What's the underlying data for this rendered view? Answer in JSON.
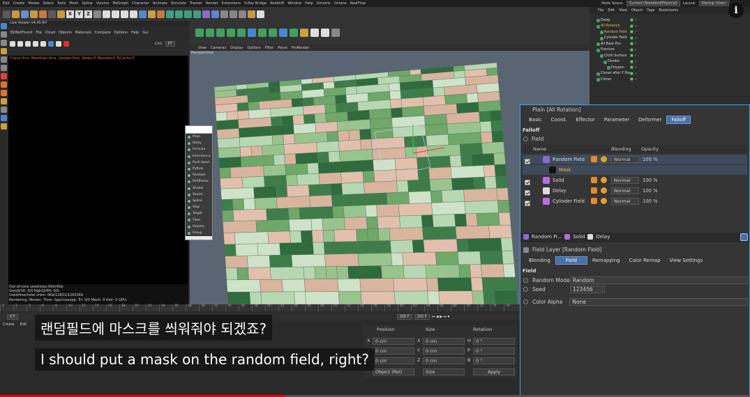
{
  "menubar": {
    "items": [
      "Edit",
      "Create",
      "Modes",
      "Select",
      "Tools",
      "Mesh",
      "Spline",
      "Volume",
      "MoGraph",
      "Character",
      "Animate",
      "Simulate",
      "Tracker",
      "Render",
      "Extensions",
      "V-Ray Bridge",
      "Redshift",
      "Window",
      "Help",
      "Omatrix",
      "Octane",
      "RealFlow"
    ],
    "node_space_label": "Node Space:",
    "node_space_value": "Current (Standard/Physical)",
    "layout_label": "Layout:",
    "layout_value": "Startup (User)"
  },
  "toolbar": {
    "axis_buttons": [
      "X",
      "Y",
      "Z"
    ]
  },
  "live_viewer": {
    "title": "Live Viewer V4.05-R7",
    "menu": [
      "File",
      "Cloud",
      "Objects",
      "Materials",
      "Compare",
      "Options",
      "Help",
      "Gui"
    ],
    "menu_prefix": "3StNotFound",
    "channel_label": "Chn:",
    "channel_value": "PT",
    "status_line": "Check:0ms, MeshGen:0ms, Update:0ms, Nodes:0 Movable:0 ToCache:0",
    "stats": [
      "Out-of-core used/max:0Kb/4Gb",
      "Grey8/16: 0/0          Rgb32/64: 0/0",
      "Used/free/total vram: 0Kb/12652/12652Kb"
    ],
    "rendering_line": "Rendering:      Ms/sec:       Time:      Spp/maxspp:        Tri: 0/0    Mesh: 0   Hair: 0      GPU:"
  },
  "viewport": {
    "menu": [
      "View",
      "Cameras",
      "Display",
      "Options",
      "Filter",
      "Panel",
      "ProRender"
    ],
    "label": "Perspective"
  },
  "field_menu": {
    "items": [
      "Plain",
      "Delay",
      "Formula",
      "Inheritance",
      "Push Apart",
      "Python",
      "Random",
      "ReEffector",
      "Shader",
      "Sound",
      "Spline",
      "Step",
      "Target",
      "Time",
      "Volume",
      "Group"
    ]
  },
  "object_manager": {
    "menu": [
      "File",
      "Edit",
      "View",
      "Object",
      "Tags",
      "Bookmarks"
    ],
    "objects": [
      {
        "name": "Delay",
        "depth": 0,
        "color": "#dddddd"
      },
      {
        "name": "All Rotation",
        "depth": 0,
        "color": "#e8b850"
      },
      {
        "name": "Random Field",
        "depth": 1,
        "color": "#e8b850"
      },
      {
        "name": "Cylinder Field",
        "depth": 1,
        "color": "#dddddd"
      },
      {
        "name": "All Base Pos",
        "depth": 0,
        "color": "#dddddd"
      },
      {
        "name": "Fracture",
        "depth": 0,
        "color": "#dddddd"
      },
      {
        "name": "Cloth Surface",
        "depth": 1,
        "color": "#dddddd"
      },
      {
        "name": "Divider",
        "depth": 2,
        "color": "#dddddd"
      },
      {
        "name": "Polygon",
        "depth": 3,
        "color": "#dddddd"
      },
      {
        "name": "Cloner after Y Pos",
        "depth": 0,
        "color": "#dddddd"
      },
      {
        "name": "Cloner",
        "depth": 0,
        "color": "#dddddd"
      }
    ]
  },
  "attributes": {
    "title": "Plain [All Rotation]",
    "tabs": [
      "Basic",
      "Coord.",
      "Effector",
      "Parameter",
      "Deformer",
      "Falloff"
    ],
    "active_tab": "Falloff",
    "section": "Falloff",
    "field_label": "Field",
    "col_name": "Name",
    "col_blending": "Blending",
    "col_opacity": "Opacity",
    "layers": [
      {
        "name": "Random Field",
        "blend": "Normal",
        "opacity": "100 %",
        "icon": "#8a6ad0"
      },
      {
        "name": "Mask",
        "blend": "",
        "opacity": "",
        "icon": "#111111"
      },
      {
        "name": "Solid",
        "blend": "Normal",
        "opacity": "100 %",
        "icon": "#b070e0"
      },
      {
        "name": "Delay",
        "blend": "Normal",
        "opacity": "100 %",
        "icon": "#dddddd"
      },
      {
        "name": "Cylinder Field",
        "blend": "Normal",
        "opacity": "100 %",
        "icon": "#b070e0"
      }
    ],
    "sub_tabs": [
      "Random Fi...",
      "Solid",
      "Delay"
    ],
    "layer_title": "Field Layer [Random Field]",
    "layer_tabs": [
      "Blending",
      "Field",
      "Remapping",
      "Color Remap",
      "View Settings"
    ],
    "layer_active_tab": "Field",
    "field_section": "Field",
    "random_mode_label": "Random Mode",
    "random_mode_value": "Random",
    "seed_label": "Seed",
    "seed_value": "123456",
    "color_alpha_label": "Color Alpha",
    "color_alpha_value": "None"
  },
  "timeline": {
    "ticks": [
      "0",
      "2",
      "4",
      "6",
      "8",
      "10",
      "12",
      "14",
      "16",
      "18",
      "20",
      "22",
      "24",
      "26",
      "28",
      "30",
      "32",
      "34",
      "36",
      "38",
      "40",
      "42",
      "44",
      "46",
      "48",
      "50",
      "52",
      "54",
      "56",
      "58",
      "60",
      "62",
      "64",
      "66",
      "68",
      "70",
      "72",
      "74",
      "76"
    ],
    "frame_start": "0 F",
    "frame_end": "200 F",
    "frame_end2": "200 F",
    "mat_menu": [
      "Create",
      "Edit"
    ]
  },
  "coords": {
    "headers": [
      "Position",
      "Size",
      "Rotation"
    ],
    "rows": [
      {
        "axis": "X",
        "pos": "0 cm",
        "size": "0 cm",
        "rot_axis": "H",
        "rot": "0 °"
      },
      {
        "axis": "Y",
        "pos": "0 cm",
        "size": "0 cm",
        "rot_axis": "P",
        "rot": "0 °"
      },
      {
        "axis": "Z",
        "pos": "0 cm",
        "size": "0 cm",
        "rot_axis": "B",
        "rot": "0 °"
      }
    ],
    "mode": "Object (Rel)",
    "size_mode": "Size",
    "apply": "Apply"
  },
  "subtitles": {
    "korean": "랜덤필드에 마스크를 씌워줘야 되겠죠?",
    "english": "I should put a mask on the random field, right?"
  },
  "video": {
    "progress": 0.38,
    "info_icon": "i"
  }
}
